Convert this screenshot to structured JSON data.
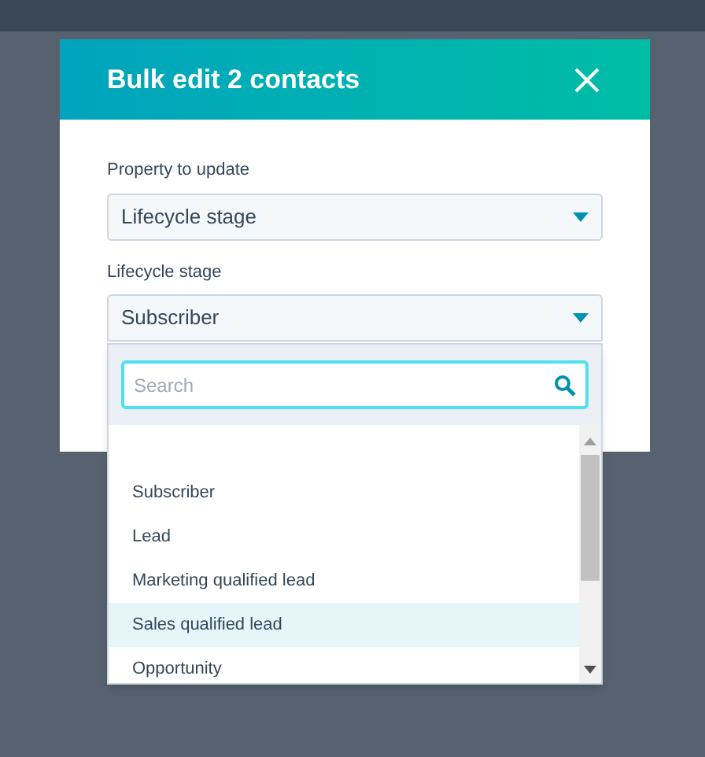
{
  "dialog": {
    "title": "Bulk edit 2 contacts"
  },
  "fields": [
    {
      "label": "Property to update",
      "value": "Lifecycle stage"
    },
    {
      "label": "Lifecycle stage",
      "value": "Subscriber",
      "expanded": true
    }
  ],
  "dropdown": {
    "search": {
      "placeholder": "Search"
    },
    "options": [
      {
        "label": "Subscriber",
        "selected": false
      },
      {
        "label": "Lead",
        "selected": false
      },
      {
        "label": "Marketing qualified lead",
        "selected": false
      },
      {
        "label": "Sales qualified lead",
        "selected": true
      },
      {
        "label": "Opportunity",
        "selected": false
      }
    ]
  }
}
